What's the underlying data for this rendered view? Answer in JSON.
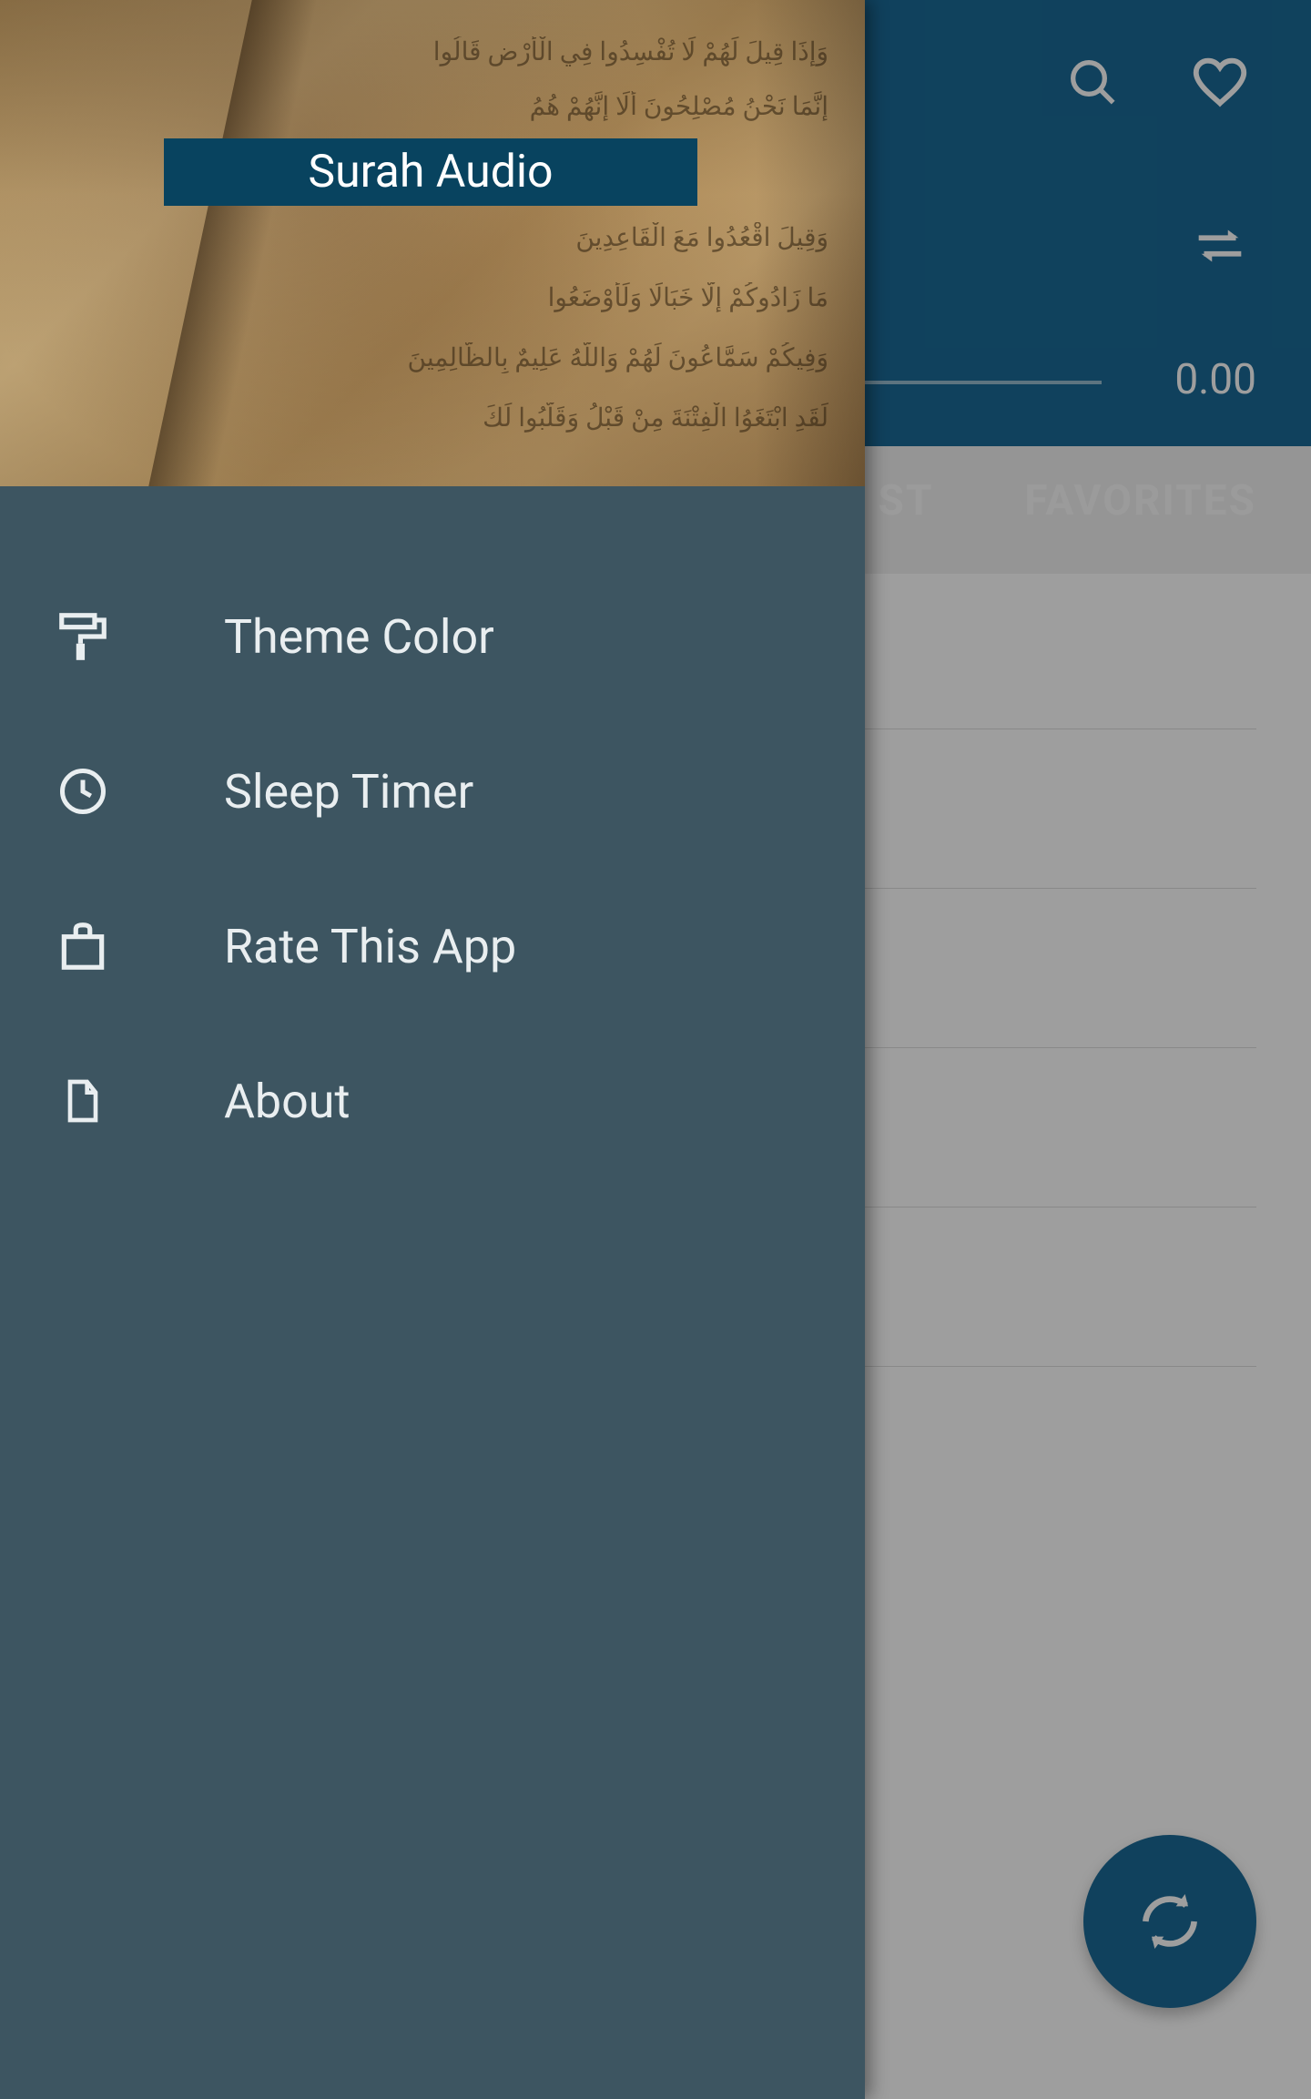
{
  "drawer": {
    "title": "Surah Audio",
    "items": [
      {
        "label": "Theme Color",
        "icon": "paint-roller-icon"
      },
      {
        "label": "Sleep Timer",
        "icon": "clock-icon"
      },
      {
        "label": "Rate This App",
        "icon": "bag-icon"
      },
      {
        "label": "About",
        "icon": "document-icon"
      }
    ]
  },
  "player": {
    "time": "0.00"
  },
  "tabs": {
    "partial": "ST",
    "favorites": "FAVORITES"
  }
}
